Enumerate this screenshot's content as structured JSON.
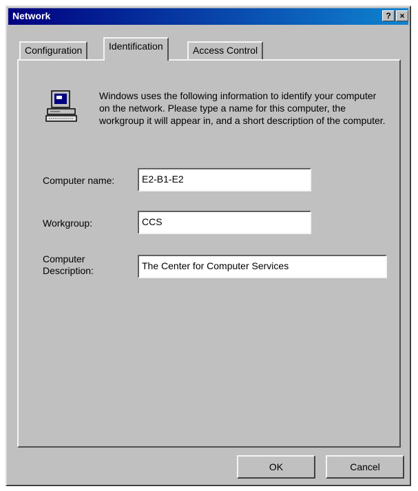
{
  "window": {
    "title": "Network",
    "help_button": "?",
    "close_button": "×"
  },
  "tabs": [
    {
      "label": "Configuration"
    },
    {
      "label": "Identification"
    },
    {
      "label": "Access Control"
    }
  ],
  "identification": {
    "icon": "computer-icon",
    "description": "Windows uses the following information to identify your computer on the network.  Please type a name for this computer, the workgroup it will appear in, and a short description of the computer.",
    "computer_name_label": "Computer name:",
    "computer_name_value": "E2-B1-E2",
    "workgroup_label": "Workgroup:",
    "workgroup_value": "CCS",
    "description_label_line1": "Computer",
    "description_label_line2": "Description:",
    "description_value": "The Center for Computer Services"
  },
  "buttons": {
    "ok": "OK",
    "cancel": "Cancel"
  }
}
